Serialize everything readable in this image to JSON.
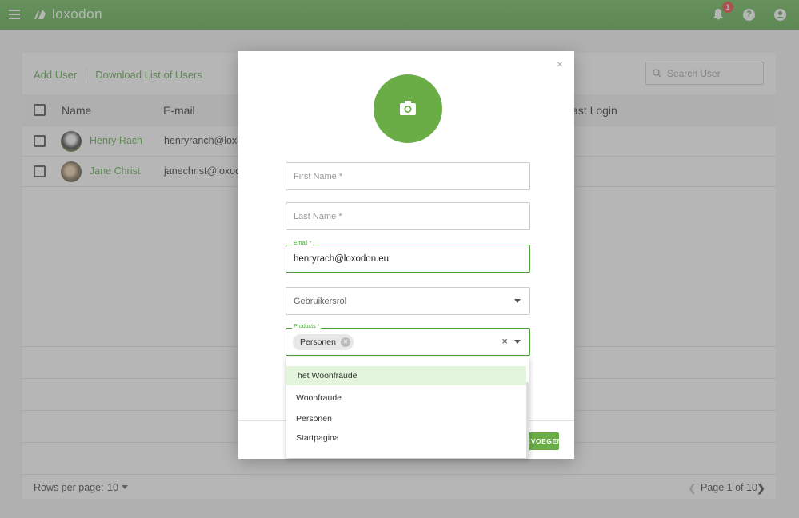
{
  "app": {
    "brand": "loxodon"
  },
  "header": {
    "notification_count": "1",
    "help_label": "?"
  },
  "toolbar": {
    "add_user": "Add User",
    "download_list": "Download List of Users",
    "search_placeholder": "Search User"
  },
  "table": {
    "columns": [
      "Name",
      "E-mail",
      "ast Login"
    ],
    "rows": [
      {
        "name": "Henry Rach",
        "email": "henryranch@loxo"
      },
      {
        "name": "Jane Christ",
        "email": "janechrist@loxod"
      }
    ]
  },
  "footer": {
    "rows_per_page_label": "Rows per page:",
    "rows_per_page_value": "10",
    "page_text": "Page 1 of 10"
  },
  "modal": {
    "close": "×",
    "first_name_placeholder": "First Name *",
    "last_name_placeholder": "Last Name *",
    "email_label": "Email *",
    "email_value": "henryrach@loxodon.eu",
    "role_placeholder": "Gebruikersrol",
    "products_label": "Products *",
    "selected_chip": "Personen",
    "clear": "×",
    "add_button": "TOEVOEGEN"
  },
  "dropdown": {
    "options": [
      "het Woonfraude",
      "Woonfraude",
      "Personen",
      "Startpagina"
    ],
    "highlighted_index": 0
  },
  "colors": {
    "brand_green": "#4ea23b",
    "accent_green": "#6aad47",
    "badge_red": "#e53935",
    "highlight": "#e3f5dc"
  }
}
